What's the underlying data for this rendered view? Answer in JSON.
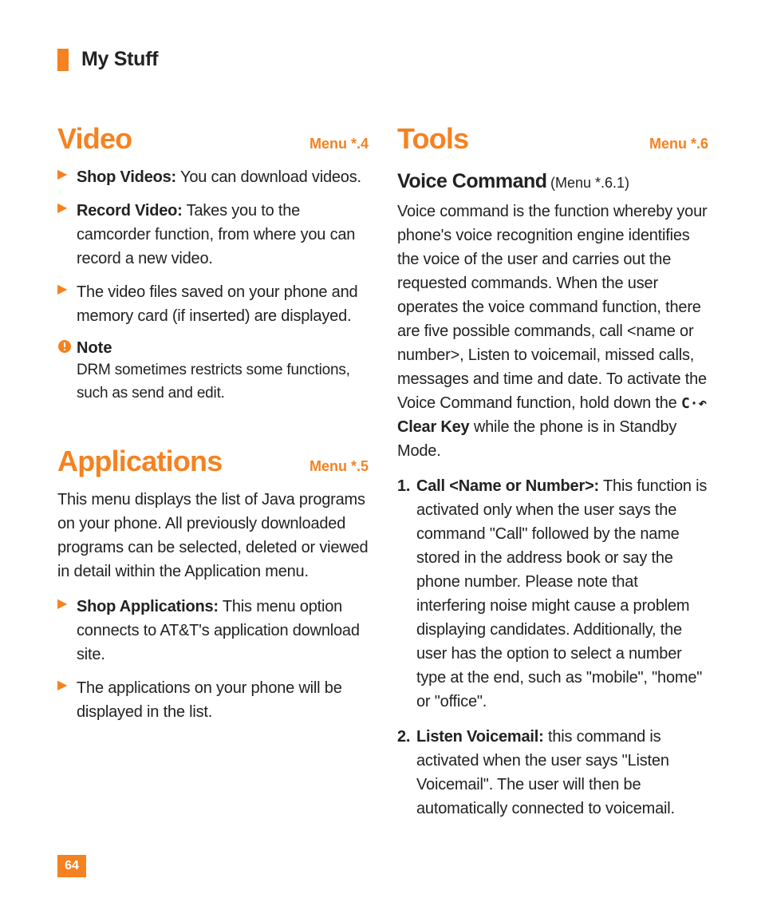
{
  "header": {
    "title": "My Stuff"
  },
  "page_number": "64",
  "left": {
    "video": {
      "title": "Video",
      "menu": "Menu *.4",
      "items": [
        {
          "bold": "Shop Videos:",
          "rest": " You can download videos."
        },
        {
          "bold": "Record Video:",
          "rest": " Takes you to the camcorder function, from where you can record a new video."
        },
        {
          "bold": "",
          "rest": "The video files saved on your phone and memory card (if inserted) are displayed."
        }
      ],
      "note": {
        "label": "Note",
        "text": "DRM sometimes restricts some functions, such as send and edit."
      }
    },
    "applications": {
      "title": "Applications",
      "menu": "Menu *.5",
      "intro": "This menu displays the list of Java programs on your phone. All previously downloaded programs can be selected, deleted or viewed in detail within the Application menu.",
      "items": [
        {
          "bold": "Shop Applications:",
          "rest": " This menu option connects to AT&T's application download site."
        },
        {
          "bold": "",
          "rest": "The applications on your phone will be displayed in the list."
        }
      ]
    }
  },
  "right": {
    "tools": {
      "title": "Tools",
      "menu": "Menu *.6",
      "voice_command": {
        "title": "Voice Command",
        "menu": "(Menu *.6.1)",
        "intro_part1": "Voice command is the function whereby your phone's voice recognition engine identifies the voice of the user and carries out the requested commands. When the user operates the voice command function, there are five possible commands, call <name or number>, Listen to voicemail, missed calls, messages and time and date. To activate the Voice Command function, hold down the ",
        "clear_key_label": " Clear Key",
        "intro_part2": " while the phone is in Standby Mode.",
        "numbered": [
          {
            "num": "1.",
            "bold": "Call <Name or Number>:",
            "rest": " This function is activated only when the user says the command \"Call\" followed by the name stored in the address book or say the phone number. Please note that interfering noise might cause a problem displaying candidates. Additionally, the user has the option to select a number type at the end, such as \"mobile\", \"home\" or \"office\"."
          },
          {
            "num": "2.",
            "bold": "Listen Voicemail:",
            "rest": " this command is activated when the user says \"Listen Voicemail\". The user will then be automatically connected to voicemail."
          }
        ]
      }
    }
  }
}
